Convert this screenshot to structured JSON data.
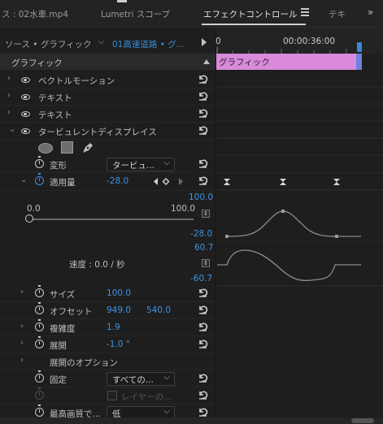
{
  "tabs": {
    "left_cut": "ス : 02水車.mp4",
    "lumetri": "Lumetri スコープ",
    "effect_controls": "エフェクトコントロール",
    "next": "テキ",
    "overflow": "»"
  },
  "source": {
    "label": "ソース • グラフィック",
    "clip": "01高速道路 • グ..."
  },
  "timeline": {
    "start_time": "0",
    "end_time": "00:00:36:00",
    "graphic_bar": "グラフィック"
  },
  "section_title": "グラフィック",
  "layers": [
    {
      "label": "ベクトルモーション"
    },
    {
      "label": "テキスト"
    },
    {
      "label": "テキスト"
    },
    {
      "label": "タービュレントディスプレイス"
    }
  ],
  "props": {
    "transform_label": "変形",
    "transform_value": "タービュ...",
    "amount_label": "適用量",
    "amount_value": "-28.0",
    "slider_min": "0.0",
    "slider_max": "100.0",
    "speed_label": "速度 : 0.0 / 秒",
    "size_label": "サイズ",
    "size_value": "100.0",
    "offset_label": "オフセット",
    "offset_x": "949.0",
    "offset_y": "540.0",
    "complexity_label": "複雑度",
    "complexity_value": "1.9",
    "evolution_label": "展開",
    "evolution_value": "-1.0 °",
    "evolution_options_label": "展開のオプション",
    "pinning_label": "固定",
    "pinning_value": "すべての...",
    "layer_checkbox_label": "レイヤーの...",
    "quality_label": "最高画質で...",
    "quality_value": "低"
  },
  "graph": {
    "value_top": "100.0",
    "value_bottom": "-28.0",
    "velocity_top": "60.7",
    "velocity_bottom": "-60.7"
  }
}
